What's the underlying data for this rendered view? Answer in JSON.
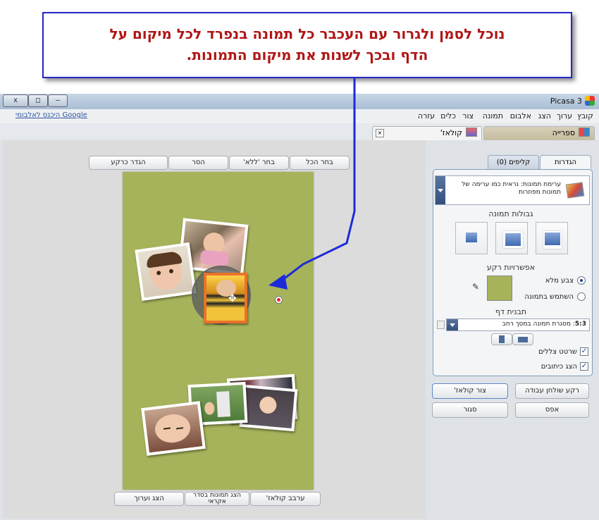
{
  "callout": {
    "line1": "נוכל לסמן ולגרור עם העכבר כל תמונה בנפרד לכל מיקום על",
    "line2": "הדף ובכך לשנות את מיקום התמונות."
  },
  "window": {
    "title": "Picasa 3",
    "controls": [
      "x",
      "□",
      "–"
    ]
  },
  "menu": {
    "items": [
      "קובץ",
      "ערוך",
      "הצג",
      "אלבום",
      "תמונה",
      "צור",
      "כלים",
      "עזרה"
    ],
    "google_link": "היכנס לאלבומי Google"
  },
  "tabs": {
    "library": "ספרייה",
    "collage": "קולאז'"
  },
  "toolbar_top": {
    "select_all": "בחר הכל",
    "select_none": "בחר 'ללא'",
    "remove": "הסר",
    "set_as_background": "הגדר כרקע"
  },
  "toolbar_bottom": {
    "shuffle_collage": "ערבב קולאז'",
    "random_order": "הצג תמונות בסדר אקראי",
    "show_edit": "הצג וערוך"
  },
  "panel": {
    "tab_settings": "הגדרות",
    "tab_clips": "קליפים (0)",
    "collage_type_line1": "ערימת תמונות: נראית כמו ערימה של",
    "collage_type_line2": "תמונות מפוזרות",
    "picture_borders": "גבולות תמונה",
    "background_options": "אפשרויות רקע",
    "solid_color": "צבע מלא",
    "use_image": "השתמש בתמונה",
    "page_format": "תבנית דף",
    "page_format_ratio": "5:3",
    "page_format_value": ": מסגרת תמונה במסך רחב",
    "draw_shadows": "שרטט צללים",
    "show_captions": "הצג כיתובים",
    "background_color": "#a6b35a"
  },
  "actions": {
    "desktop_background": "רקע שולחן עבודה",
    "create_collage": "צור קולאז'",
    "reset": "אפס",
    "close": "סגור"
  },
  "colors": {
    "callout_text": "#b01616",
    "callout_border": "#2626c8",
    "arrow": "#1b2bd8",
    "page_background": "#a6b35a"
  }
}
